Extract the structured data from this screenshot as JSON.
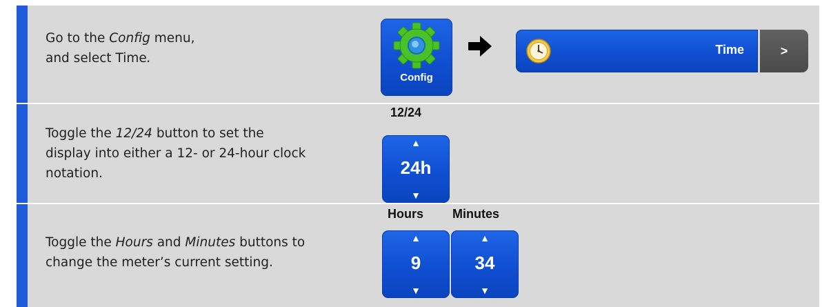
{
  "steps": [
    {
      "lines": [
        [
          {
            "text": "Go to the ",
            "em": false
          },
          {
            "text": "Config",
            "em": true
          },
          {
            "text": " menu,",
            "em": false
          }
        ],
        [
          {
            "text": "and select Time",
            "em": false
          },
          {
            "text": ".",
            "em": true
          }
        ]
      ],
      "config_button": {
        "label": "Config",
        "icon": "gear-icon"
      },
      "arrow_icon": "right-arrow-icon",
      "time_item": {
        "label": "Time",
        "icon": "clock-icon",
        "more_label": ">"
      }
    },
    {
      "lines": [
        [
          {
            "text": "Toggle the ",
            "em": false
          },
          {
            "text": "12/24",
            "em": true
          },
          {
            "text": " button to set the",
            "em": false
          }
        ],
        [
          {
            "text": "display into either a 12- or 24-hour clock",
            "em": false
          }
        ],
        [
          {
            "text": "notation.",
            "em": false
          }
        ]
      ],
      "stepper": {
        "title": "12/24",
        "value": "24h",
        "up": "▲",
        "down": "▼"
      }
    },
    {
      "lines": [
        [
          {
            "text": "Toggle the ",
            "em": false
          },
          {
            "text": "Hours",
            "em": true
          },
          {
            "text": " and ",
            "em": false
          },
          {
            "text": "Minutes",
            "em": true
          },
          {
            "text": " buttons to",
            "em": false
          }
        ],
        [
          {
            "text": "change the meter’s current setting.",
            "em": false
          }
        ]
      ],
      "hours": {
        "title": "Hours",
        "value": "9",
        "up": "▲",
        "down": "▼"
      },
      "minutes": {
        "title": "Minutes",
        "value": "34",
        "up": "▲",
        "down": "▼"
      }
    }
  ],
  "colors": {
    "accent_bar": "#1f5bd8",
    "row_bg": "#d9d9d9",
    "button_blue": "#1258d8",
    "button_gray": "#555555",
    "gear_green": "#49c22a"
  }
}
